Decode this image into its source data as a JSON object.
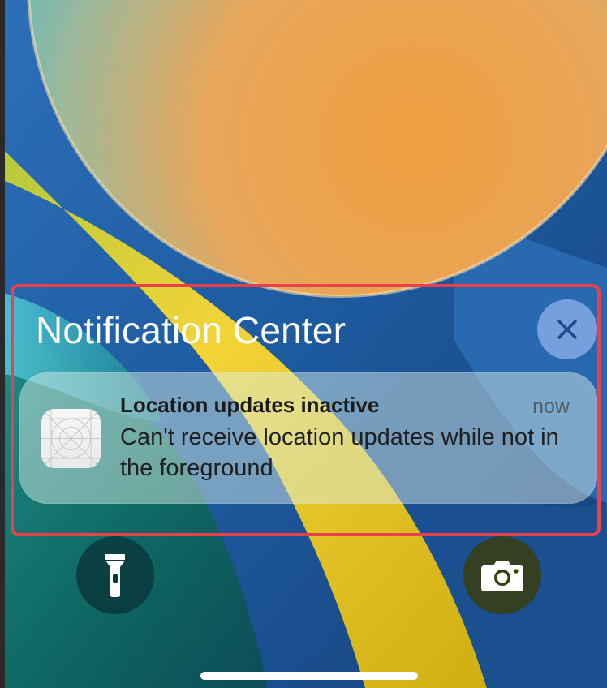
{
  "notification_center": {
    "title": "Notification Center"
  },
  "notification": {
    "title": "Location updates inactive",
    "time": "now",
    "body": "Can't receive location updates while not in the foreground"
  },
  "icons": {
    "clear": "close-icon",
    "app": "app-placeholder-icon",
    "flashlight": "flashlight-icon",
    "camera": "camera-icon"
  },
  "colors": {
    "highlight": "#e8414c",
    "wallpaper_blue": "#1f5ea8",
    "wallpaper_orange": "#ee9a4a",
    "wallpaper_yellow": "#f1d338"
  }
}
